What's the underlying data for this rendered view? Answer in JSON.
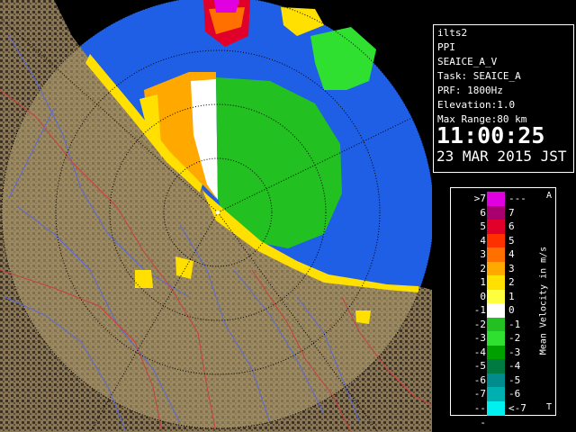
{
  "info": {
    "station": "ilts2",
    "mode": "PPI",
    "product": "SEAICE_A_V",
    "task": "Task: SEAICE_A",
    "prf": "PRF: 1800Hz",
    "elevation": "Elevation:1.0",
    "max_range": "Max Range:80 km",
    "time": "11:00:25",
    "date": "23 MAR 2015 JST"
  },
  "legend": {
    "title": "Mean Velocity in m/s",
    "corner_top": "A",
    "corner_bottom": "T",
    "rows": [
      {
        "left": ">7",
        "right": "---",
        "color": "#e000e0"
      },
      {
        "left": "6",
        "right": "7",
        "color": "#a8006e"
      },
      {
        "left": "5",
        "right": "6",
        "color": "#e0002a"
      },
      {
        "left": "4",
        "right": "5",
        "color": "#ff3000"
      },
      {
        "left": "3",
        "right": "4",
        "color": "#ff7000"
      },
      {
        "left": "2",
        "right": "3",
        "color": "#ffa800"
      },
      {
        "left": "1",
        "right": "2",
        "color": "#ffe000"
      },
      {
        "left": "0",
        "right": "1",
        "color": "#ffff40"
      },
      {
        "left": "-1",
        "right": "0",
        "color": "#ffffff"
      },
      {
        "left": "-2",
        "right": "-1",
        "color": "#22c020"
      },
      {
        "left": "-3",
        "right": "-2",
        "color": "#30e030"
      },
      {
        "left": "-4",
        "right": "-3",
        "color": "#00a000"
      },
      {
        "left": "-5",
        "right": "-4",
        "color": "#007a40"
      },
      {
        "left": "-6",
        "right": "-5",
        "color": "#008c8c"
      },
      {
        "left": "-7",
        "right": "-6",
        "color": "#00b0b0"
      },
      {
        "left": "---",
        "right": "<-7",
        "color": "#00f0f0"
      }
    ]
  },
  "colors": {
    "sea": "#2060e0",
    "land": "#8a7650",
    "land_dark": "#3e3222"
  }
}
